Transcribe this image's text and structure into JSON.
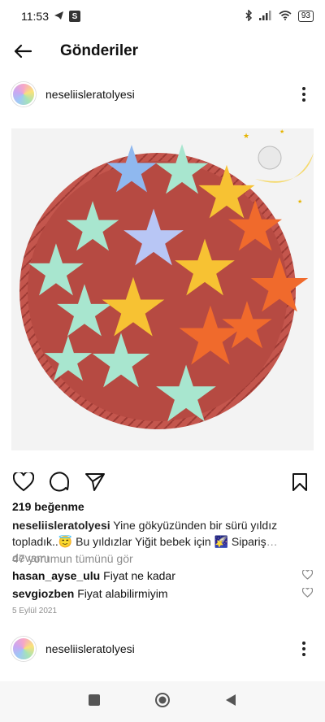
{
  "status": {
    "time": "11:53",
    "battery": "93"
  },
  "header": {
    "title": "Gönderiler"
  },
  "post": {
    "username": "neseliisleratolyesi",
    "likes": "219 beğenme",
    "caption_user": "neseliisleratolyesi",
    "caption_line1": " Yine gökyüzünden bir sürü yıldız",
    "caption_line2": "topladık..😇 Bu yıldızlar Yiğit bebek için 🌠 Sipariş",
    "caption_more": "… devamı",
    "view_comments": "47 yorumun tümünü gör",
    "comments": [
      {
        "user": "hasan_ayse_ulu",
        "text": "Fiyat ne kadar"
      },
      {
        "user": "sevgiozben",
        "text": "Fiyat alabilirmiyim"
      }
    ],
    "date": "5 Eylül 2021"
  },
  "next_post": {
    "username": "neseliisleratolyesi"
  },
  "colors": {
    "basket": "#c0504a",
    "star_yellow": "#f7c233",
    "star_mint": "#a8e6cf",
    "star_orange": "#f06a2c",
    "star_blue": "#8fb8ef"
  }
}
